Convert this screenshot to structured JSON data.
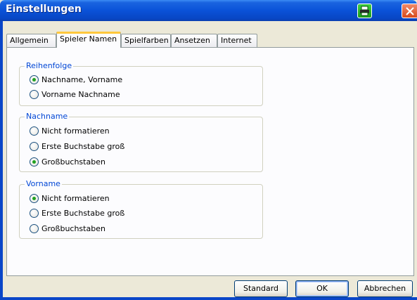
{
  "window": {
    "title": "Einstellungen"
  },
  "icons": {
    "print": "printer-icon",
    "close": "close-icon"
  },
  "tabs": [
    {
      "label": "Allgemein"
    },
    {
      "label": "Spieler Namen",
      "active": true
    },
    {
      "label": "Spielfarben"
    },
    {
      "label": "Ansetzen"
    },
    {
      "label": "Internet"
    }
  ],
  "groups": {
    "reihenfolge": {
      "label": "Reihenfolge",
      "options": [
        "Nachname, Vorname",
        "Vorname Nachname"
      ],
      "selected": 0
    },
    "nachname": {
      "label": "Nachname",
      "options": [
        "Nicht formatieren",
        "Erste Buchstabe groß",
        "Großbuchstaben"
      ],
      "selected": 2
    },
    "vorname": {
      "label": "Vorname",
      "options": [
        "Nicht formatieren",
        "Erste Buchstabe groß",
        "Großbuchstaben"
      ],
      "selected": 0
    }
  },
  "buttons": {
    "standard": "Standard",
    "ok": "OK",
    "cancel": "Abbrechen"
  },
  "colors": {
    "accent": "#0a52d8",
    "group_label": "#0046d5",
    "radio_selected": "#21a121",
    "tab_highlight": "#ffc83c"
  }
}
